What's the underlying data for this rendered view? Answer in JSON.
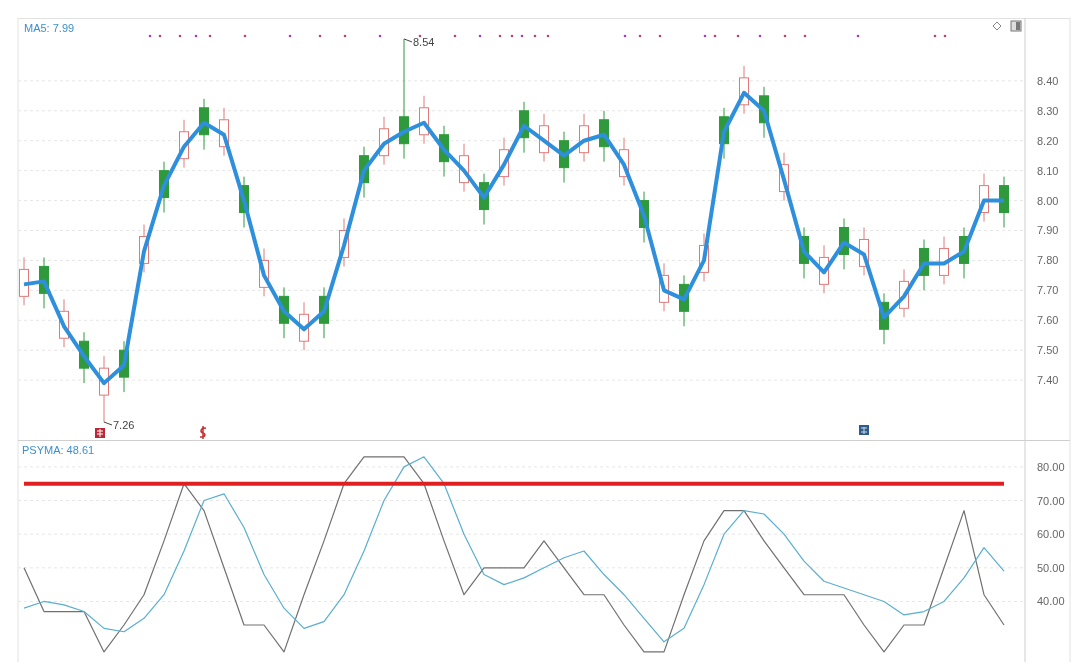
{
  "price_panel": {
    "indicator_label": "MA5: 7.99",
    "chart_data": {
      "type": "candlestick",
      "grid": true,
      "ohlc": [
        [
          7.68,
          7.81,
          7.65,
          7.77
        ],
        [
          7.78,
          7.81,
          7.64,
          7.69
        ],
        [
          7.54,
          7.67,
          7.51,
          7.63
        ],
        [
          7.53,
          7.56,
          7.39,
          7.44
        ],
        [
          7.35,
          7.48,
          7.26,
          7.44
        ],
        [
          7.5,
          7.53,
          7.36,
          7.41
        ],
        [
          7.79,
          7.92,
          7.76,
          7.88
        ],
        [
          8.1,
          8.13,
          7.96,
          8.01
        ],
        [
          8.14,
          8.27,
          8.11,
          8.23
        ],
        [
          8.31,
          8.34,
          8.17,
          8.22
        ],
        [
          8.18,
          8.31,
          8.15,
          8.27
        ],
        [
          8.05,
          8.08,
          7.91,
          7.96
        ],
        [
          7.71,
          7.84,
          7.68,
          7.8
        ],
        [
          7.68,
          7.71,
          7.54,
          7.59
        ],
        [
          7.53,
          7.66,
          7.5,
          7.62
        ],
        [
          7.68,
          7.71,
          7.54,
          7.59
        ],
        [
          7.81,
          7.94,
          7.78,
          7.9
        ],
        [
          8.15,
          8.18,
          8.01,
          8.06
        ],
        [
          8.15,
          8.28,
          8.12,
          8.24
        ],
        [
          8.28,
          8.54,
          8.14,
          8.19
        ],
        [
          8.22,
          8.35,
          8.19,
          8.31
        ],
        [
          8.22,
          8.25,
          8.08,
          8.13
        ],
        [
          8.06,
          8.19,
          8.03,
          8.15
        ],
        [
          8.06,
          8.09,
          7.92,
          7.97
        ],
        [
          8.08,
          8.21,
          8.05,
          8.17
        ],
        [
          8.3,
          8.33,
          8.16,
          8.21
        ],
        [
          8.16,
          8.29,
          8.13,
          8.25
        ],
        [
          8.2,
          8.23,
          8.06,
          8.11
        ],
        [
          8.16,
          8.29,
          8.13,
          8.25
        ],
        [
          8.27,
          8.3,
          8.13,
          8.18
        ],
        [
          8.08,
          8.21,
          8.05,
          8.17
        ],
        [
          8.0,
          8.03,
          7.86,
          7.91
        ],
        [
          7.66,
          7.79,
          7.63,
          7.75
        ],
        [
          7.72,
          7.75,
          7.58,
          7.63
        ],
        [
          7.76,
          7.89,
          7.73,
          7.85
        ],
        [
          8.28,
          8.31,
          8.14,
          8.19
        ],
        [
          8.32,
          8.45,
          8.29,
          8.41
        ],
        [
          8.35,
          8.38,
          8.21,
          8.26
        ],
        [
          8.03,
          8.16,
          8.0,
          8.12
        ],
        [
          7.88,
          7.91,
          7.74,
          7.79
        ],
        [
          7.72,
          7.85,
          7.69,
          7.81
        ],
        [
          7.91,
          7.94,
          7.77,
          7.82
        ],
        [
          7.78,
          7.91,
          7.75,
          7.87
        ],
        [
          7.66,
          7.69,
          7.52,
          7.57
        ],
        [
          7.64,
          7.77,
          7.61,
          7.73
        ],
        [
          7.84,
          7.87,
          7.7,
          7.75
        ],
        [
          7.75,
          7.88,
          7.72,
          7.84
        ],
        [
          7.88,
          7.91,
          7.74,
          7.79
        ],
        [
          7.96,
          8.09,
          7.93,
          8.05
        ],
        [
          8.05,
          8.08,
          7.91,
          7.96
        ]
      ],
      "series": [
        {
          "type": "line",
          "color": "#2e8fdc",
          "values": [
            7.72,
            7.73,
            7.58,
            7.48,
            7.39,
            7.45,
            7.83,
            8.05,
            8.18,
            8.26,
            8.22,
            8.0,
            7.75,
            7.63,
            7.57,
            7.63,
            7.85,
            8.1,
            8.19,
            8.23,
            8.26,
            8.17,
            8.1,
            8.01,
            8.12,
            8.25,
            8.2,
            8.15,
            8.2,
            8.22,
            8.12,
            7.95,
            7.7,
            7.67,
            7.8,
            8.23,
            8.36,
            8.3,
            8.07,
            7.83,
            7.76,
            7.86,
            7.82,
            7.61,
            7.68,
            7.79,
            7.79,
            7.83,
            8.0,
            8.0
          ]
        }
      ],
      "ylim": [
        7.2,
        8.61
      ],
      "yticks": [
        {
          "value": 8.4,
          "label": "8.40"
        },
        {
          "value": 8.3,
          "label": "8.30"
        },
        {
          "value": 8.2,
          "label": "8.20"
        },
        {
          "value": 8.1,
          "label": "8.10"
        },
        {
          "value": 8.0,
          "label": "8.00"
        },
        {
          "value": 7.9,
          "label": "7.90"
        },
        {
          "value": 7.8,
          "label": "7.80"
        },
        {
          "value": 7.7,
          "label": "7.70"
        },
        {
          "value": 7.6,
          "label": "7.60"
        },
        {
          "value": 7.5,
          "label": "7.50"
        },
        {
          "value": 7.4,
          "label": "7.40"
        }
      ],
      "annotations": [
        {
          "text": "8.54"
        },
        {
          "text": "7.26"
        }
      ]
    }
  },
  "psy_panel": {
    "indicator_label": "PSYMA: 48.61",
    "chart_data": {
      "type": "line",
      "grid": true,
      "series": [
        {
          "color": "#707070",
          "values": [
            50,
            37,
            37,
            37,
            25,
            33,
            42,
            58,
            75,
            67,
            50,
            33,
            33,
            25,
            42,
            58,
            75,
            83,
            83,
            83,
            75,
            58,
            42,
            50,
            50,
            50,
            58,
            50,
            42,
            42,
            33,
            25,
            25,
            42,
            58,
            67,
            67,
            58,
            50,
            42,
            42,
            42,
            33,
            25,
            33,
            33,
            50,
            67,
            42,
            33
          ]
        },
        {
          "color": "#5aaed0",
          "values": [
            38,
            40,
            39,
            37,
            32,
            31,
            35,
            42,
            55,
            70,
            72,
            62,
            48,
            38,
            32,
            34,
            42,
            55,
            70,
            80,
            83,
            75,
            60,
            48,
            45,
            47,
            50,
            53,
            55,
            48,
            42,
            35,
            28,
            32,
            45,
            60,
            67,
            66,
            60,
            52,
            46,
            44,
            42,
            40,
            36,
            37,
            40,
            47,
            56,
            49
          ]
        },
        {
          "color": "#e02020",
          "values": [
            75,
            75,
            75,
            75,
            75,
            75,
            75,
            75,
            75,
            75,
            75,
            75,
            75,
            75,
            75,
            75,
            75,
            75,
            75,
            75,
            75,
            75,
            75,
            75,
            75,
            75,
            75,
            75,
            75,
            75,
            75,
            75,
            75,
            75,
            75,
            75,
            75,
            75,
            75,
            75,
            75,
            75,
            75,
            75,
            75,
            75,
            75,
            75,
            75,
            75
          ]
        }
      ],
      "ylim": [
        22,
        88
      ],
      "yticks": [
        {
          "value": 80,
          "label": "80.00"
        },
        {
          "value": 70,
          "label": "70.00"
        },
        {
          "value": 60,
          "label": "60.00"
        },
        {
          "value": 50,
          "label": "50.00"
        },
        {
          "value": 40,
          "label": "40.00"
        }
      ]
    }
  }
}
